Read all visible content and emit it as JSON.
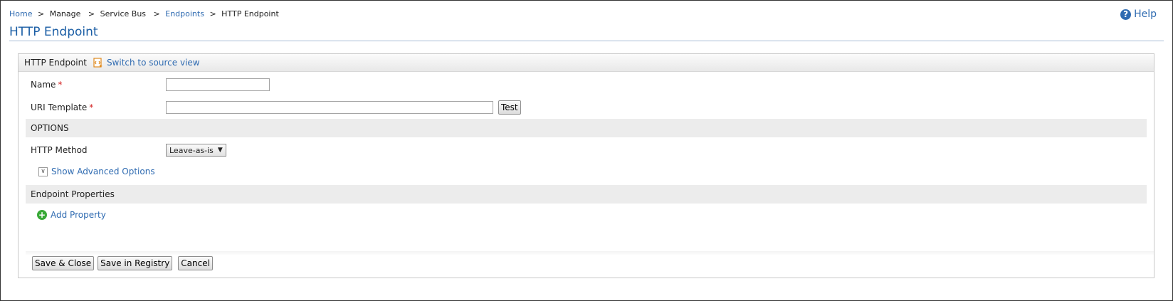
{
  "breadcrumb": {
    "home": "Home",
    "sep": ">",
    "manage": "Manage",
    "service_bus": "Service Bus",
    "endpoints": "Endpoints",
    "current": "HTTP Endpoint"
  },
  "page": {
    "title": "HTTP Endpoint",
    "help": "Help",
    "help_glyph": "?"
  },
  "panel": {
    "header_title": "HTTP Endpoint",
    "switch_source": "Switch to source view",
    "name_label": "Name",
    "uri_label": "URI Template",
    "required_mark": "*",
    "name_value": "",
    "uri_value": "",
    "test_button": "Test",
    "options_header": "OPTIONS",
    "http_method_label": "HTTP Method",
    "http_method_value": "Leave-as-is",
    "dropdown_arrow": "▼",
    "show_advanced": "Show Advanced Options",
    "checkbox_glyph": "∨",
    "endpoint_props_header": "Endpoint Properties",
    "add_property": "Add Property",
    "plus_glyph": "+"
  },
  "buttons": {
    "save_close": "Save & Close",
    "save_registry": "Save in Registry",
    "cancel": "Cancel"
  },
  "colors": {
    "link": "#2f6bb1",
    "title": "#1b5ea5",
    "required": "#d21f1f",
    "add_icon": "#39a937"
  }
}
